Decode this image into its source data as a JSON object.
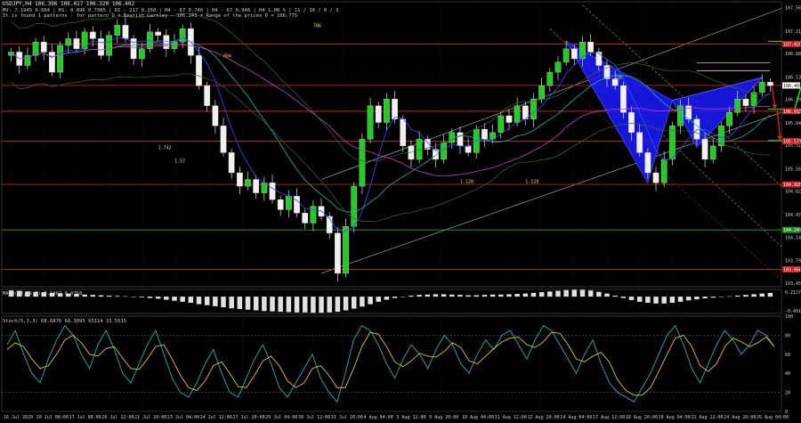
{
  "header": {
    "symbol_line": "USDJPY,H4  106.396 106.417 106.320 106.402",
    "indicator_line": "MV: 7.1945  0.664 | H1: 0.896  0.7985 | D1 -  217  0.250 | H4 - 67  0.746 | H4 - 67  0.946 | H4  1.00 %  | 11 / 10 / 0 / 3",
    "pattern_line": "It is found 1 patterns  -  for pattern D = Bearish Gartley - 106.241 = Range of the prices D = 106.775"
  },
  "price_axis": {
    "ticks": [
      "107.565",
      "107.215",
      "106.880",
      "106.530",
      "106.195",
      "105.845",
      "105.510",
      "105.160",
      "104.825",
      "104.475",
      "104.140",
      "103.790",
      "103.455"
    ],
    "tick_values": [
      107.565,
      107.215,
      106.88,
      106.53,
      106.195,
      105.845,
      105.51,
      105.16,
      104.825,
      104.475,
      104.14,
      103.79,
      103.455
    ],
    "range": [
      103.4,
      107.65
    ],
    "level_tags": [
      {
        "label": "107.020",
        "value": 107.02,
        "color": "#cc2020",
        "line": "#cc2020"
      },
      {
        "label": "106.402",
        "value": 106.402,
        "color": "#ffffff",
        "line": "#cc2020"
      },
      {
        "label": "106.018",
        "value": 106.018,
        "color": "#cc2020",
        "line": "#cc2020"
      },
      {
        "label": "105.571",
        "value": 105.571,
        "color": "#cc2020",
        "line": "#cc2020"
      },
      {
        "label": "104.926",
        "value": 104.926,
        "color": "#cc2020",
        "line": "#cc2020"
      },
      {
        "label": "104.247",
        "value": 104.247,
        "color": "#228b22",
        "line": "#22aa22"
      },
      {
        "label": "103.660",
        "value": 103.66,
        "color": "#cc2020",
        "line": "#cc2020"
      }
    ]
  },
  "time_axis": {
    "labels": [
      "16 Jul 2020",
      "20 Jul 08:00",
      "17 Jul 08:00",
      "20 Jul 12:00",
      "21 Jul 20:00",
      "23 Jul 04:00",
      "24 Jul 12:00",
      "27 Jul 20:00",
      "29 Jul 04:00",
      "30 Jul 12:00",
      "31 Jul 20:00",
      "4 Aug 04:00",
      "5 Aug 12:00",
      "6 Aug 20:00",
      "10 Aug 04:00",
      "11 Aug 12:00",
      "12 Aug 20:00",
      "14 Aug 04:00",
      "17 Aug 12:00",
      "18 Aug 20:00",
      "20 Aug 04:00",
      "21 Aug 12:00",
      "24 Aug 20:00",
      "26 Aug 04:00"
    ]
  },
  "chart_data": [
    {
      "type": "candlestick",
      "title": "USDJPY,H4",
      "y_range": [
        103.4,
        107.65
      ],
      "close_series": [
        106.9,
        106.7,
        106.85,
        107.05,
        106.9,
        106.6,
        107.0,
        107.1,
        106.95,
        107.2,
        107.1,
        106.85,
        107.15,
        107.3,
        107.1,
        106.8,
        106.95,
        107.2,
        107.15,
        106.95,
        107.05,
        107.25,
        106.85,
        106.4,
        106.1,
        105.8,
        105.4,
        105.1,
        104.9,
        105.0,
        104.8,
        104.95,
        104.7,
        104.55,
        104.75,
        104.5,
        104.35,
        104.6,
        104.45,
        104.2,
        103.6,
        104.3,
        104.9,
        105.6,
        106.1,
        105.85,
        106.2,
        105.9,
        105.5,
        105.3,
        105.6,
        105.45,
        105.3,
        105.55,
        105.7,
        105.5,
        105.4,
        105.75,
        105.6,
        105.7,
        105.95,
        105.85,
        106.1,
        105.9,
        106.2,
        106.4,
        106.6,
        106.75,
        106.95,
        106.8,
        107.05,
        106.9,
        106.7,
        106.5,
        106.4,
        106.0,
        105.7,
        105.4,
        105.1,
        104.95,
        105.3,
        105.8,
        106.1,
        105.9,
        105.6,
        105.3,
        105.5,
        105.8,
        106.0,
        106.2,
        106.1,
        106.3,
        106.45,
        106.4
      ],
      "levels": [
        107.02,
        106.402,
        106.018,
        105.571,
        104.926,
        104.247,
        103.66
      ],
      "pattern": {
        "name": "Bearish Gartley",
        "X": 107.06,
        "A": 104.95,
        "B": 106.18,
        "C": 105.48,
        "D": 106.52,
        "annotations": [
          "1.128",
          "1.742",
          "1.57",
          "1.128",
          "786",
          "804",
          "786"
        ]
      },
      "arrows": [
        {
          "direction": "up",
          "color": "#22cc22",
          "target": 107.06
        },
        {
          "direction": "down",
          "color": "#dd2020",
          "target": 106.05
        },
        {
          "direction": "down",
          "color": "#dd2020",
          "target": 105.58
        }
      ]
    },
    {
      "type": "bar",
      "title": "MACD(12,26,9) 0.1467 0.0768",
      "y_ticks": [
        "0.2127",
        "-0.4917"
      ],
      "y_range": [
        -0.49,
        0.21
      ],
      "values": [
        0.18,
        0.17,
        0.15,
        0.14,
        0.13,
        0.11,
        0.1,
        0.09,
        0.08,
        0.06,
        0.05,
        0.04,
        0.03,
        0.02,
        0.01,
        0.0,
        -0.02,
        -0.04,
        -0.06,
        -0.09,
        -0.12,
        -0.15,
        -0.18,
        -0.22,
        -0.25,
        -0.28,
        -0.31,
        -0.34,
        -0.36,
        -0.38,
        -0.4,
        -0.42,
        -0.43,
        -0.44,
        -0.45,
        -0.46,
        -0.46,
        -0.47,
        -0.47,
        -0.46,
        -0.44,
        -0.4,
        -0.35,
        -0.29,
        -0.22,
        -0.15,
        -0.09,
        -0.04,
        0.0,
        0.03,
        0.05,
        0.06,
        0.07,
        0.07,
        0.06,
        0.05,
        0.04,
        0.04,
        0.05,
        0.06,
        0.06,
        0.07,
        0.08,
        0.09,
        0.11,
        0.13,
        0.15,
        0.17,
        0.19,
        0.2,
        0.2,
        0.18,
        0.14,
        0.09,
        0.03,
        -0.04,
        -0.1,
        -0.15,
        -0.18,
        -0.2,
        -0.2,
        -0.18,
        -0.15,
        -0.11,
        -0.08,
        -0.05,
        -0.03,
        -0.01,
        0.01,
        0.03,
        0.05,
        0.07,
        0.09,
        0.11
      ]
    },
    {
      "type": "line",
      "title": "Stoch(5,3,3) 68.6876 68.3095  93114  33.5515",
      "y_ticks": [
        "100",
        "80",
        "60",
        "40",
        "20",
        "0"
      ],
      "y_range": [
        0,
        100
      ],
      "series": [
        {
          "color": "#20b2aa",
          "values": [
            70,
            85,
            60,
            40,
            30,
            55,
            75,
            90,
            80,
            60,
            45,
            70,
            85,
            65,
            40,
            30,
            50,
            70,
            85,
            60,
            35,
            20,
            15,
            30,
            50,
            65,
            40,
            20,
            15,
            35,
            55,
            70,
            50,
            25,
            15,
            30,
            45,
            60,
            35,
            20,
            10,
            40,
            75,
            90,
            85,
            70,
            50,
            35,
            55,
            70,
            60,
            45,
            65,
            80,
            70,
            50,
            40,
            60,
            75,
            65,
            80,
            85,
            70,
            55,
            75,
            90,
            85,
            70,
            55,
            40,
            60,
            75,
            50,
            30,
            20,
            15,
            10,
            25,
            40,
            60,
            80,
            90,
            70,
            45,
            30,
            50,
            70,
            85,
            75,
            60,
            70,
            85,
            80,
            68
          ]
        },
        {
          "color": "#e6c229",
          "values": [
            65,
            72,
            68,
            55,
            45,
            48,
            60,
            75,
            80,
            72,
            60,
            58,
            66,
            68,
            56,
            45,
            44,
            55,
            68,
            70,
            55,
            38,
            25,
            22,
            32,
            48,
            52,
            40,
            26,
            25,
            38,
            53,
            58,
            48,
            32,
            25,
            30,
            45,
            48,
            38,
            25,
            25,
            45,
            68,
            83,
            81,
            68,
            52,
            47,
            53,
            61,
            58,
            57,
            63,
            72,
            67,
            53,
            50,
            58,
            66,
            73,
            77,
            78,
            70,
            67,
            73,
            83,
            82,
            70,
            55,
            52,
            58,
            62,
            52,
            33,
            22,
            17,
            17,
            25,
            42,
            60,
            77,
            80,
            68,
            48,
            42,
            50,
            68,
            77,
            73,
            68,
            72,
            78,
            68
          ]
        }
      ]
    }
  ]
}
